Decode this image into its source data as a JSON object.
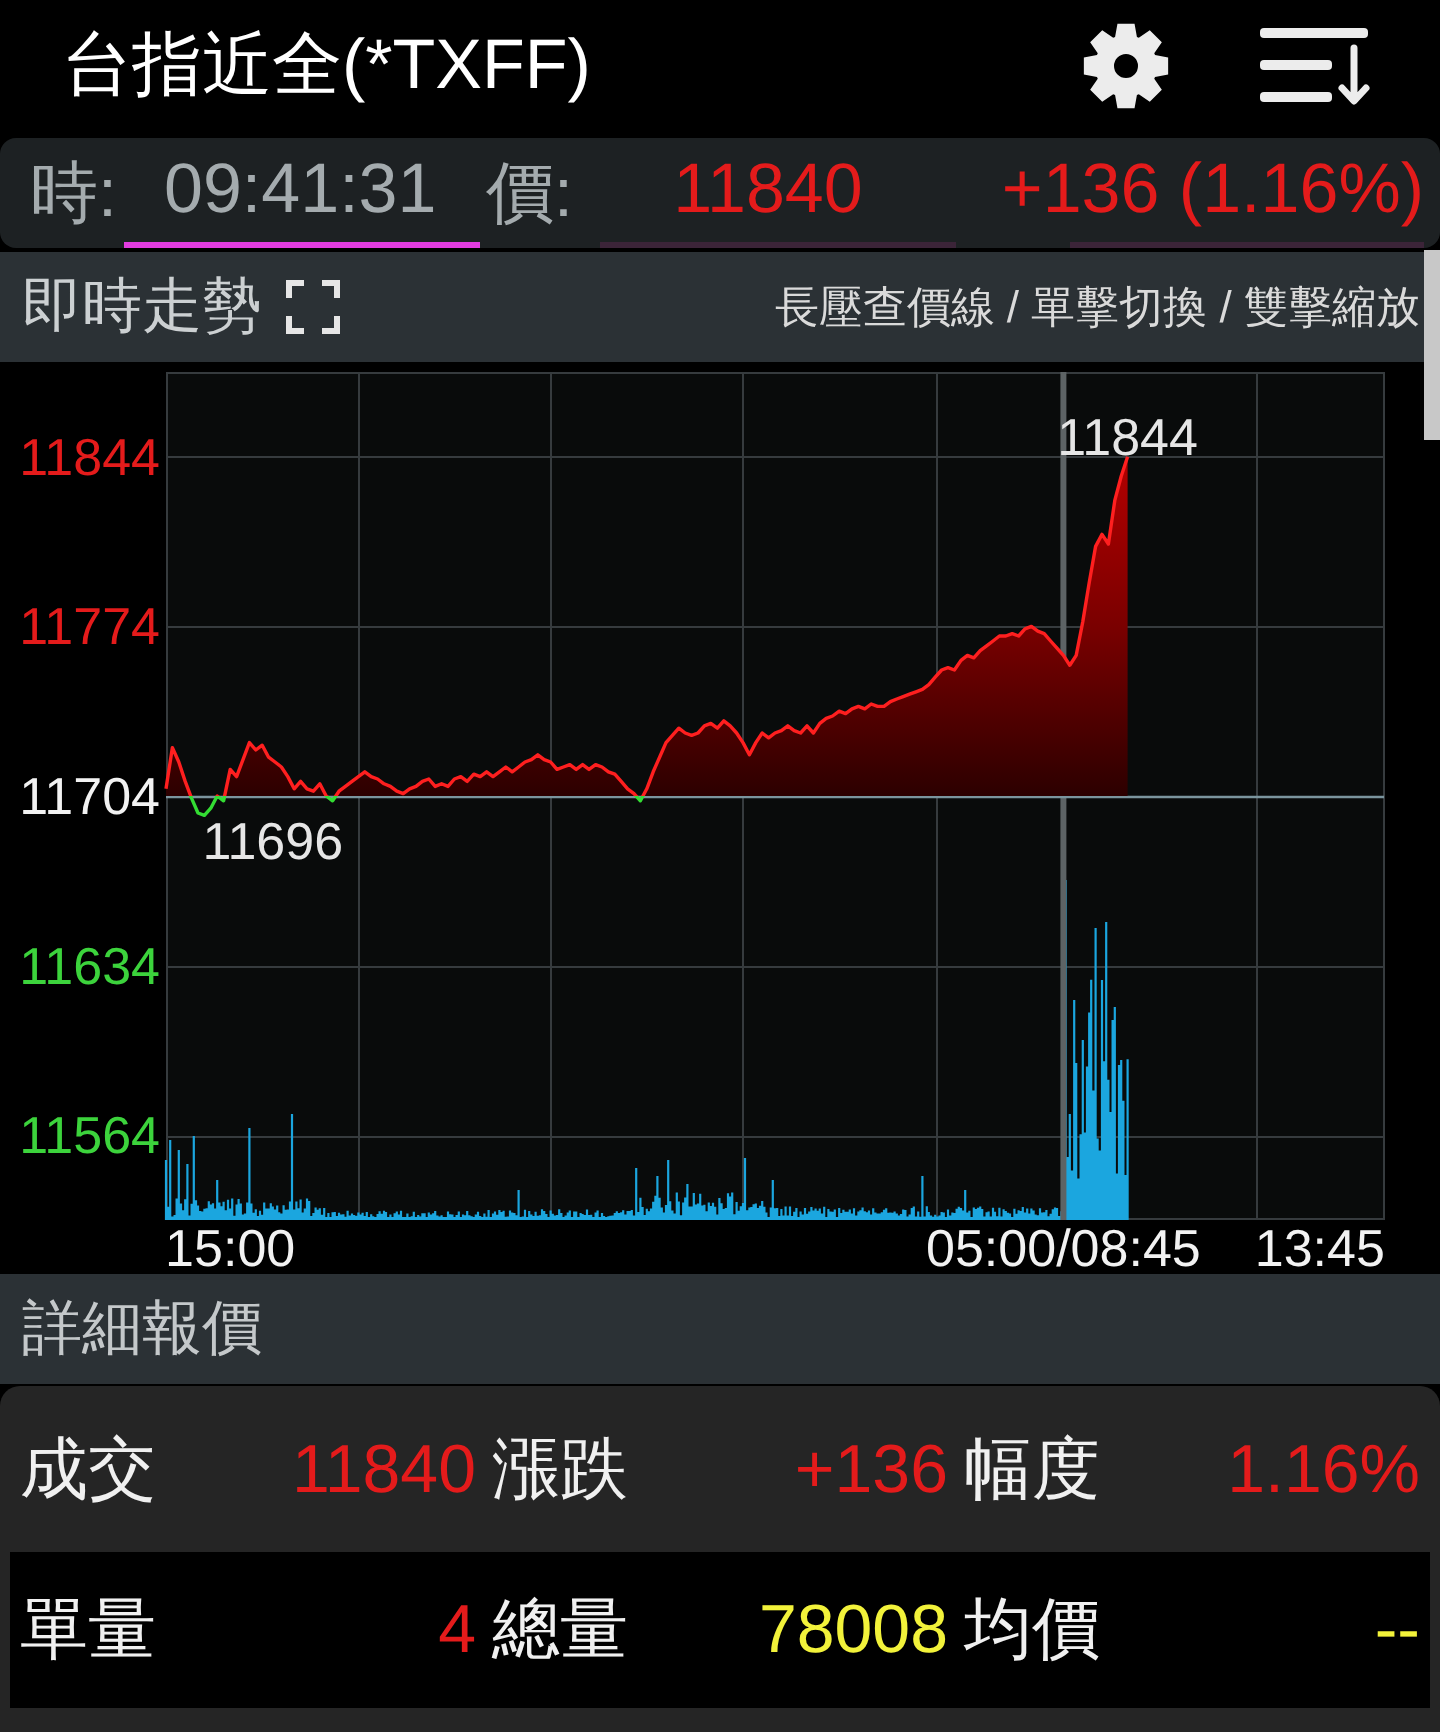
{
  "app_bar": {
    "title": "台指近全(*TXFF)"
  },
  "quote_bar": [
    {
      "label": "時:",
      "value": "09:41:31",
      "color": "#a4abae",
      "selected": true
    },
    {
      "label": "價:",
      "value": "11840",
      "color": "#e41b1b",
      "selected": false
    },
    {
      "value": "+136 (1.16%)",
      "color": "#e41b1b",
      "selected": false
    }
  ],
  "trend_section": {
    "title": "即時走勢",
    "hint": "長壓查價線 / 單擊切換 / 雙擊縮放",
    "chart_data": {
      "type": "area",
      "grid": true,
      "categories": [
        null,
        null,
        null,
        null,
        null,
        null,
        null,
        null,
        null,
        null,
        "15:00",
        null,
        null,
        null,
        null,
        null,
        null,
        null,
        null,
        null,
        null,
        null,
        null,
        null,
        null,
        null,
        null,
        null,
        null,
        null,
        null,
        null,
        null,
        null,
        null,
        null,
        null,
        null,
        null,
        null,
        null,
        null,
        null,
        null,
        null,
        null,
        null,
        null,
        null,
        null,
        null,
        null,
        null,
        null,
        null,
        null,
        null,
        null,
        null,
        null,
        null,
        null,
        null,
        null,
        null,
        null,
        null,
        null,
        null,
        null,
        null,
        null,
        null,
        null,
        null,
        null,
        null,
        null,
        null,
        null,
        null,
        null,
        null,
        null,
        null,
        null,
        null,
        null,
        null,
        null,
        null,
        null,
        null,
        null,
        null,
        null,
        null,
        null,
        null,
        null,
        null,
        null,
        null,
        null,
        null,
        null,
        null,
        null,
        null,
        null,
        null,
        null,
        null,
        null,
        null,
        null,
        null,
        null,
        null,
        null,
        null,
        null,
        null,
        null,
        null,
        null,
        null,
        null,
        null,
        null,
        null,
        null,
        null,
        null,
        null,
        null,
        null,
        null,
        null,
        null,
        "05:00/08:45",
        null,
        null,
        null,
        null,
        null,
        null,
        null,
        null,
        null,
        null,
        null,
        null,
        null,
        null,
        null,
        null,
        null,
        null,
        null,
        null,
        null,
        null,
        null,
        null,
        null,
        null,
        null,
        null,
        null,
        null,
        null,
        null,
        null,
        null,
        null,
        null,
        null,
        null,
        null,
        "13:45",
        null,
        null,
        null,
        null,
        null,
        null,
        null,
        null,
        null,
        null
      ],
      "values": [
        11707,
        11724,
        11718,
        11710,
        11703,
        11697,
        11696,
        11699,
        11704,
        11702,
        11715,
        11712,
        11719,
        11726,
        11723,
        11725,
        11720,
        11718,
        11716,
        11712,
        11707,
        11710,
        11707,
        11706,
        11709,
        11704,
        11702,
        11706,
        11708,
        11710,
        11712,
        11714,
        11712,
        11711,
        11709,
        11708,
        11706,
        11705,
        11707,
        11708,
        11710,
        11711,
        11708,
        11709,
        11708,
        11711,
        11712,
        11710,
        11713,
        11712,
        11714,
        11712,
        11714,
        11716,
        11714,
        11716,
        11718,
        11719,
        11721,
        11719,
        11718,
        11715,
        11716,
        11717,
        11715,
        11717,
        11715,
        11717,
        11716,
        11714,
        11713,
        11710,
        11707,
        11705,
        11702,
        11707,
        11714,
        11720,
        11726,
        11729,
        11732,
        11730,
        11729,
        11730,
        11733,
        11734,
        11732,
        11735,
        11733,
        11730,
        11726,
        11721,
        11726,
        11730,
        11728,
        11730,
        11731,
        11733,
        11731,
        11730,
        11733,
        11730,
        11734,
        11736,
        11737,
        11739,
        11738,
        11740,
        11741,
        11740,
        11742,
        11741,
        11741,
        11743,
        11744,
        11745,
        11746,
        11747,
        11748,
        11750,
        11753,
        11756,
        11757,
        11756,
        11760,
        11762,
        11761,
        11764,
        11766,
        11768,
        11770,
        11770,
        11771,
        11770,
        11773,
        11774,
        11772,
        11771,
        11768,
        11765,
        11762,
        11758,
        11762,
        11776,
        11792,
        11807,
        11812,
        11808,
        11826,
        11836,
        11844,
        null,
        null,
        null,
        null,
        null,
        null,
        null,
        null,
        null,
        null,
        null,
        null,
        null,
        null,
        null,
        null,
        null,
        null,
        null,
        null,
        null,
        null,
        null,
        null,
        null,
        null,
        null,
        null,
        null,
        null,
        null,
        null,
        null,
        null,
        null,
        null,
        null,
        null,
        null,
        null
      ],
      "ylim": [
        11529,
        11879
      ],
      "yticks": [
        11844,
        11774,
        11704,
        11634,
        11564
      ],
      "ref_lines": [
        {
          "axis": "y",
          "value": 11704
        },
        {
          "axis": "x",
          "value": "05:00/08:45"
        }
      ],
      "annotations": [
        {
          "text": "11844",
          "y": 11844
        },
        "11696"
      ]
    }
  },
  "detail_section": {
    "title": "詳細報價",
    "rows": [
      {
        "fields": [
          {
            "label": "成交",
            "value": "11840",
            "color": "#e41b1b"
          },
          {
            "label": "漲跌",
            "value": "+136",
            "color": "#e41b1b"
          },
          {
            "label": "幅度",
            "value": "1.16%",
            "color": "#e41b1b"
          }
        ]
      },
      {
        "fields": [
          {
            "label": "單量",
            "value": "4",
            "color": "#e41b1b"
          },
          {
            "label": "總量",
            "value": "78008",
            "color": "#f2f23a"
          },
          {
            "label": "均價",
            "value": "--",
            "color": "#f2f23a"
          }
        ]
      }
    ]
  }
}
